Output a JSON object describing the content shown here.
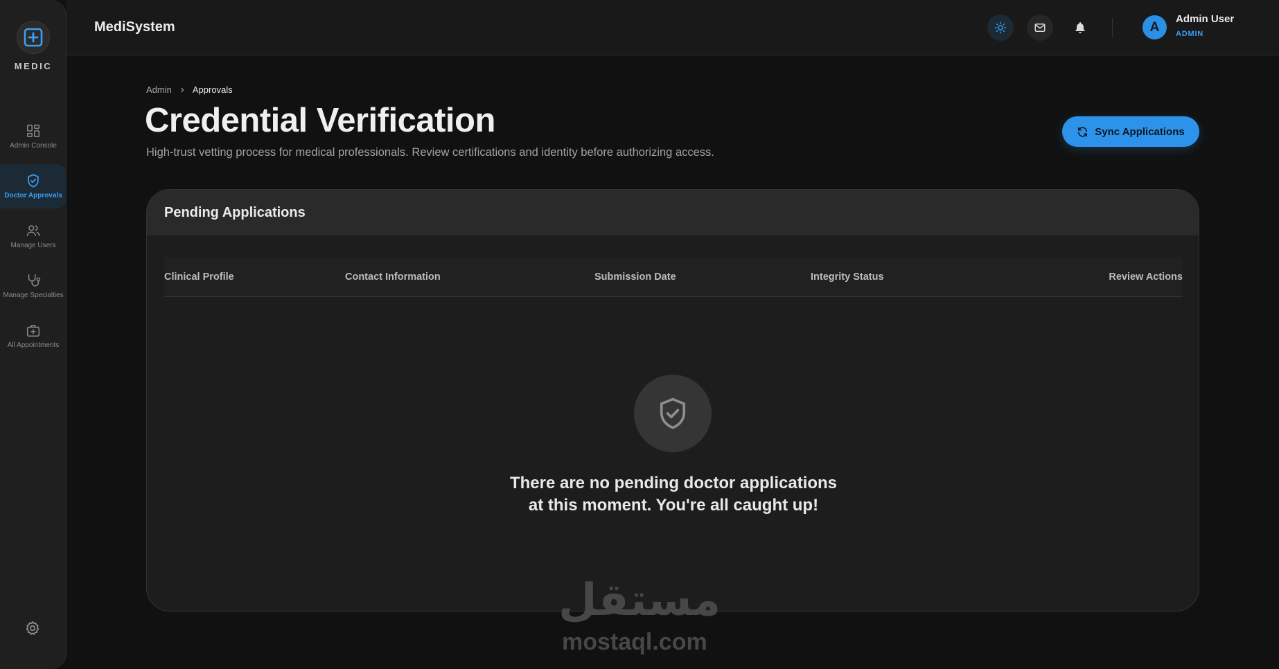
{
  "sidebar": {
    "logo_text": "MEDIC",
    "items": [
      {
        "label": "Admin Console",
        "icon": "grid-icon",
        "active": false
      },
      {
        "label": "Doctor Approvals",
        "icon": "shield-check-icon",
        "active": true
      },
      {
        "label": "Manage Users",
        "icon": "users-icon",
        "active": false
      },
      {
        "label": "Manage Specialties",
        "icon": "stethoscope-icon",
        "active": false
      },
      {
        "label": "All Appointments",
        "icon": "medical-kit-icon",
        "active": false
      }
    ],
    "settings_icon": "gear-icon"
  },
  "header": {
    "brand": "MediSystem",
    "icons": [
      "sun-icon",
      "mail-icon",
      "bell-icon"
    ],
    "user": {
      "initial": "A",
      "name": "Admin User",
      "role": "ADMIN"
    }
  },
  "breadcrumb": {
    "root": "Admin",
    "current": "Approvals"
  },
  "page": {
    "title": "Credential Verification",
    "subtitle": "High-trust vetting process for medical professionals. Review certifications and identity before authorizing access.",
    "sync_button": "Sync Applications"
  },
  "card": {
    "title": "Pending Applications",
    "columns": [
      "Clinical Profile",
      "Contact Information",
      "Submission Date",
      "Integrity Status",
      "Review Actions"
    ],
    "empty_line1": "There are no pending doctor applications",
    "empty_line2": "at this moment. You're all caught up!"
  },
  "watermark": {
    "arabic": "مستقل",
    "latin": "mostaql.com"
  },
  "colors": {
    "accent": "#2d93ea",
    "background": "#111111",
    "surface": "#1d1d1d"
  }
}
